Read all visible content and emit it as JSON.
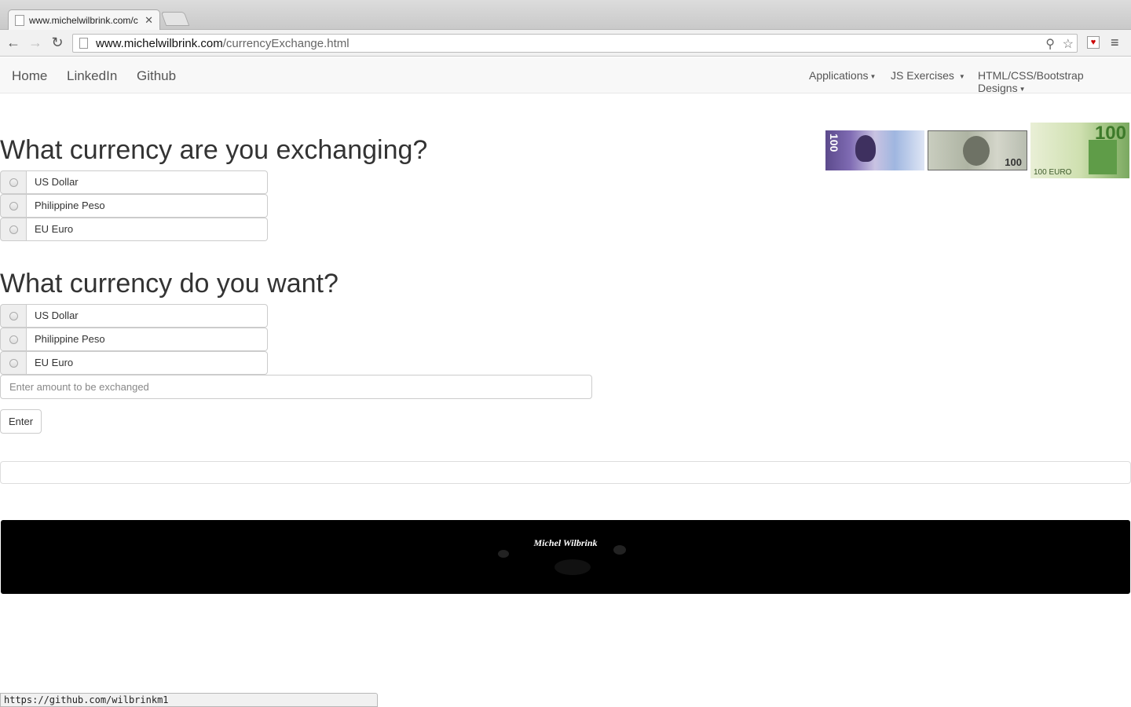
{
  "browser": {
    "tab_title": "www.michelwilbrink.com/c",
    "url_host": "www.michelwilbrink.com",
    "url_path": "/currencyExchange.html",
    "status_url": "https://github.com/wilbrinkm1"
  },
  "nav": {
    "left": [
      "Home",
      "LinkedIn",
      "Github"
    ],
    "right": [
      "Applications",
      "JS Exercises",
      "HTML/CSS/Bootstrap Designs"
    ]
  },
  "from": {
    "heading": "What currency are you exchanging?",
    "options": [
      "US Dollar",
      "Philippine Peso",
      "EU Euro"
    ]
  },
  "to": {
    "heading": "What currency do you want?",
    "options": [
      "US Dollar",
      "Philippine Peso",
      "EU Euro"
    ]
  },
  "amount": {
    "placeholder": "Enter amount to be exchanged",
    "value": ""
  },
  "enter_label": "Enter",
  "result_text": "",
  "footer": {
    "signature": "Michel Wilbrink"
  },
  "banknotes": {
    "peso_label": "100",
    "dollar_label": "100",
    "euro_label": "100",
    "euro_corner": "100 EURO"
  },
  "colors": {
    "footer_bg": "#000000",
    "navbar_bg": "#f8f8f8",
    "text": "#333333"
  }
}
